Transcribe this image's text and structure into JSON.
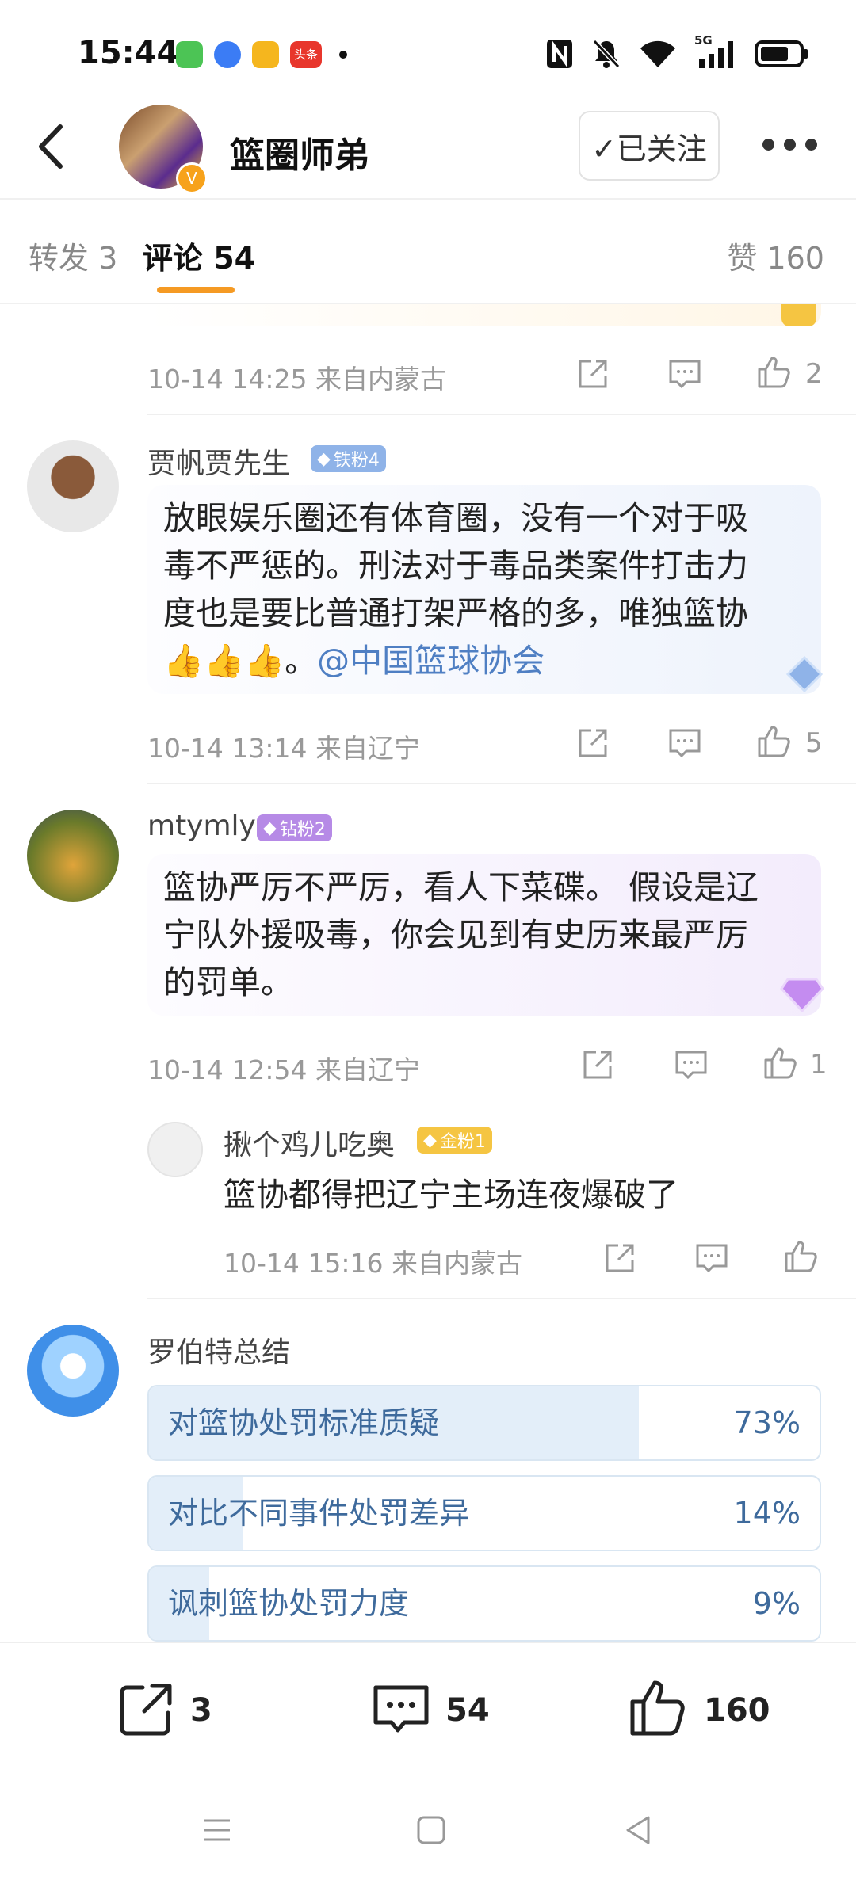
{
  "status_bar": {
    "time": "15:44",
    "icons": [
      "wechat-icon",
      "browser-icon",
      "weibo-icon",
      "toutiao-icon",
      "dot-icon",
      "nfc-icon",
      "mute-icon",
      "wifi-icon",
      "signal-5g-icon",
      "battery-icon"
    ],
    "toutiao_label": "头条",
    "network": "5G"
  },
  "header": {
    "back_icon": "chevron-left-icon",
    "title": "篮圈师弟",
    "follow_label": "✓已关注",
    "more_icon": "more-dots-icon"
  },
  "tabs": [
    {
      "label": "转发 3"
    },
    {
      "label": "评论 54"
    },
    {
      "label": "赞 160"
    }
  ],
  "comments": [
    {
      "meta": "10-14 14:25  来自内蒙古",
      "likes": "2"
    },
    {
      "user": "贾帆贾先生",
      "badge": "铁粉4",
      "text_lines": [
        "放眼娱乐圈还有体育圈，没有一个对于吸",
        "毒不严惩的。刑法对于毒品类案件打击力",
        "度也是要比普通打架严格的多，唯独篮协"
      ],
      "emoji": "👍👍👍",
      "text_tail": "。",
      "mention": "@中国篮球协会",
      "meta": "10-14 13:14  来自辽宁",
      "likes": "5"
    },
    {
      "user": "mtymly",
      "badge": "钻粉2",
      "text_lines": [
        "篮协严厉不严厉，看人下菜碟。 假设是辽",
        "宁队外援吸毒，你会见到有史历来最严厉",
        "的罚单。"
      ],
      "meta": "10-14 12:54  来自辽宁",
      "likes": "1"
    }
  ],
  "reply": {
    "user": "揪个鸡儿吃奥",
    "badge": "金粉1",
    "text": "篮协都得把辽宁主场连夜爆破了",
    "meta": "10-14 15:16  来自内蒙古"
  },
  "summary": {
    "title": "罗伯特总结",
    "options": [
      {
        "label": "对篮协处罚标准质疑",
        "pct_text": "73%",
        "fraction": 0.73
      },
      {
        "label": "对比不同事件处罚差异",
        "pct_text": "14%",
        "fraction": 0.14
      },
      {
        "label": "讽刺篮协处罚力度",
        "pct_text": "9%",
        "fraction": 0.09
      }
    ]
  },
  "toolbar": {
    "repost_count": "3",
    "comment_count": "54",
    "like_count": "160"
  },
  "colors": {
    "accent": "#f59a23",
    "link": "#4f7fc3",
    "bar_fill": "#e3eef9"
  }
}
